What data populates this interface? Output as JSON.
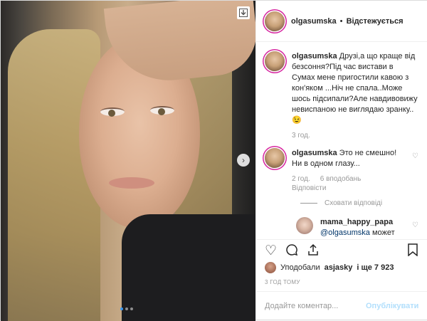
{
  "post": {
    "username": "olgasumska",
    "follow_label": "Відстежується",
    "separator": "•"
  },
  "photo": {
    "download_icon": "download-icon",
    "next_icon": "chevron-right-icon",
    "carousel": {
      "count": 3,
      "active": 1
    }
  },
  "comments": [
    {
      "username": "olgasumska",
      "text": "Друзі,а що краще від безсоння?Під час вистави в Сумах мене пригостили кавою з кон'яком ...Ніч не спала..Може шось підсипали?Але навдивовижу невиспаною не виглядаю зранку..😉",
      "time": "3 год."
    },
    {
      "username": "olgasumska",
      "text": "Это не смешно!Ни в одном глазу...",
      "time": "2 год.",
      "likes": "6 вподобань",
      "reply_label": "Відповісти",
      "hide_replies": "Сховати відповіді",
      "replies": [
        {
          "username": "mama_happy_papa",
          "mention": "@olgasumska",
          "text": "может перевозбуждение ?от какой-нибудь ситуации?"
        }
      ]
    }
  ],
  "actions": {
    "like_icon": "heart-icon",
    "comment_icon": "comment-icon",
    "share_icon": "share-icon",
    "save_icon": "bookmark-icon"
  },
  "likes": {
    "prefix": "Уподобали",
    "user": "asjasky",
    "suffix": "і ще 7 923"
  },
  "timestamp": "3 ГОД ТОМУ",
  "add_comment": {
    "placeholder": "Додайте коментар...",
    "post_label": "Опублікувати"
  },
  "colors": {
    "accent": "#3897f0",
    "post_disabled": "#b2dffc",
    "story_ring": "#d6249f"
  }
}
